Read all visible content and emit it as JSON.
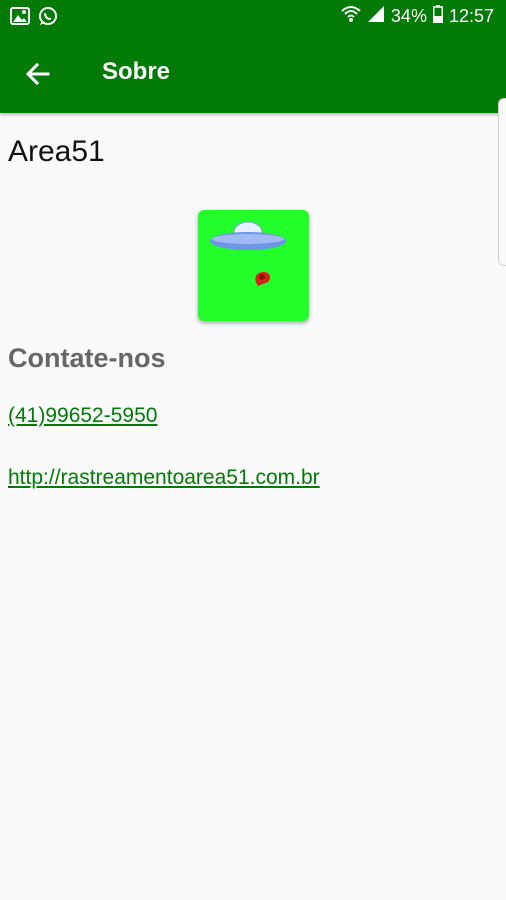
{
  "status_bar": {
    "battery": "34%",
    "time": "12:57"
  },
  "app_bar": {
    "title": "Sobre"
  },
  "about": {
    "app_name": "Area51",
    "contact_heading": "Contate-nos",
    "phone": "(41)99652-5950",
    "website": "http://rastreamentoarea51.com.br"
  },
  "colors": {
    "primary": "#017b06",
    "logo_background": "#22ff2a",
    "heading_gray": "#666666"
  }
}
